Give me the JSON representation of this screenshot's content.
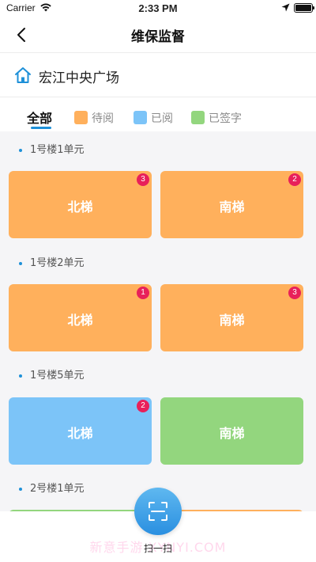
{
  "status_bar": {
    "carrier": "Carrier",
    "time": "2:33 PM"
  },
  "nav": {
    "title": "维保监督",
    "back_icon": "chevron-left-icon"
  },
  "location": {
    "icon": "home-icon",
    "name": "宏江中央广场"
  },
  "filters": {
    "all_label": "全部",
    "items": [
      {
        "label": "待阅",
        "color": "#ffb05c"
      },
      {
        "label": "已阅",
        "color": "#7cc4f8"
      },
      {
        "label": "已签字",
        "color": "#93d67e"
      }
    ]
  },
  "sections": [
    {
      "label": "1号楼1单元",
      "cards": [
        {
          "label": "北梯",
          "status": "待阅",
          "color": "#ffb05c",
          "badge": "3"
        },
        {
          "label": "南梯",
          "status": "待阅",
          "color": "#ffb05c",
          "badge": "2"
        }
      ]
    },
    {
      "label": "1号楼2单元",
      "cards": [
        {
          "label": "北梯",
          "status": "待阅",
          "color": "#ffb05c",
          "badge": "1"
        },
        {
          "label": "南梯",
          "status": "待阅",
          "color": "#ffb05c",
          "badge": "3"
        }
      ]
    },
    {
      "label": "1号楼5单元",
      "cards": [
        {
          "label": "北梯",
          "status": "已阅",
          "color": "#7cc4f8",
          "badge": "2"
        },
        {
          "label": "南梯",
          "status": "已签字",
          "color": "#93d67e",
          "badge": ""
        }
      ]
    },
    {
      "label": "2号楼1单元",
      "cards": []
    }
  ],
  "bottom": {
    "scan_label": "扫一扫",
    "scan_icon": "scan-icon",
    "watermark": "新意手游 XYNYI.COM"
  }
}
